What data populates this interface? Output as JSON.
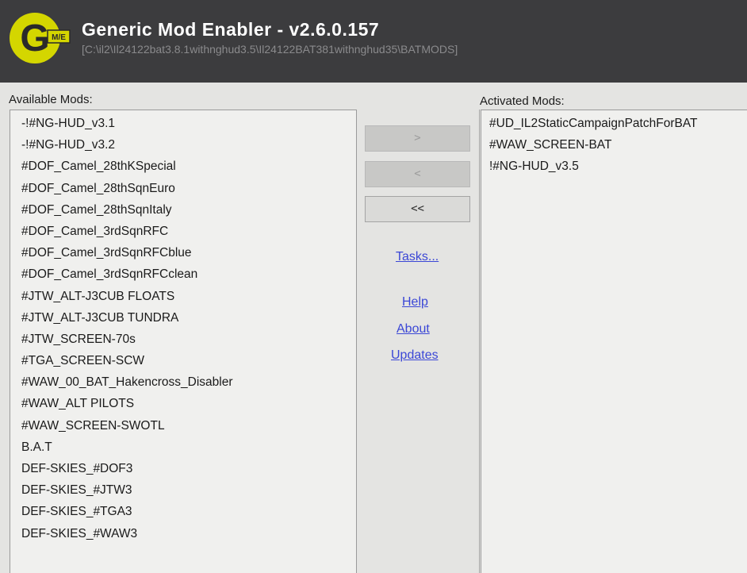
{
  "window": {
    "title": "Generic Mod Enabler - v2.6.0.157",
    "path": "[C:\\il2\\Il24122bat3.8.1withnghud3.5\\Il24122BAT381withnghud35\\BATMODS]",
    "logo_letter": "G",
    "logo_badge": "M/E"
  },
  "available": {
    "label": "Available Mods:",
    "items": [
      "-!#NG-HUD_v3.1",
      "-!#NG-HUD_v3.2",
      "#DOF_Camel_28thKSpecial",
      "#DOF_Camel_28thSqnEuro",
      "#DOF_Camel_28thSqnItaly",
      "#DOF_Camel_3rdSqnRFC",
      "#DOF_Camel_3rdSqnRFCblue",
      "#DOF_Camel_3rdSqnRFCclean",
      "#JTW_ALT-J3CUB FLOATS",
      "#JTW_ALT-J3CUB TUNDRA",
      "#JTW_SCREEN-70s",
      "#TGA_SCREEN-SCW",
      "#WAW_00_BAT_Hakencross_Disabler",
      "#WAW_ALT PILOTS",
      "#WAW_SCREEN-SWOTL",
      "B.A.T",
      "DEF-SKIES_#DOF3",
      "DEF-SKIES_#JTW3",
      "DEF-SKIES_#TGA3",
      "DEF-SKIES_#WAW3"
    ]
  },
  "activated": {
    "label": "Activated Mods:",
    "items": [
      "#UD_IL2StaticCampaignPatchForBAT",
      "#WAW_SCREEN-BAT",
      "!#NG-HUD_v3.5"
    ]
  },
  "buttons": {
    "activate": ">",
    "deactivate": "<",
    "deactivate_all": "<<"
  },
  "links": {
    "tasks": "Tasks...",
    "help": "Help",
    "about": "About",
    "updates": "Updates"
  },
  "colors": {
    "header_bg": "#3c3c3e",
    "logo_yellow": "#d4d600",
    "link": "#3b47d6"
  }
}
